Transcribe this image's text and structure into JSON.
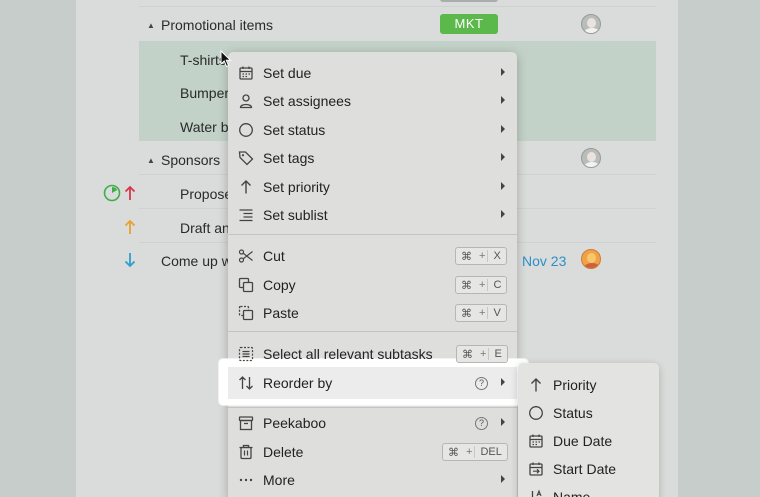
{
  "tasks": {
    "rows": [
      {
        "label": "Promotional items",
        "tag": "MKT"
      },
      {
        "label": "T-shirts"
      },
      {
        "label": "Bumper"
      },
      {
        "label": "Water b"
      },
      {
        "label": "Sponsors"
      },
      {
        "label": "Propose"
      },
      {
        "label": "Draft an"
      },
      {
        "label": "Come up w",
        "date": "Nov 23"
      }
    ]
  },
  "context_menu": {
    "items": [
      {
        "label": "Set due",
        "icon": "calendar-icon",
        "submenu": true
      },
      {
        "label": "Set assignees",
        "icon": "person-icon",
        "submenu": true
      },
      {
        "label": "Set status",
        "icon": "circle-icon",
        "submenu": true
      },
      {
        "label": "Set tags",
        "icon": "tag-icon",
        "submenu": true
      },
      {
        "label": "Set priority",
        "icon": "arrow-up-icon",
        "submenu": true
      },
      {
        "label": "Set sublist",
        "icon": "sublist-icon",
        "submenu": true
      },
      {
        "label": "Cut",
        "icon": "scissors-icon",
        "shortcut": [
          "⌘",
          "+",
          "X"
        ]
      },
      {
        "label": "Copy",
        "icon": "copy-icon",
        "shortcut": [
          "⌘",
          "+",
          "C"
        ]
      },
      {
        "label": "Paste",
        "icon": "paste-icon",
        "shortcut": [
          "⌘",
          "+",
          "V"
        ]
      },
      {
        "label": "Select all relevant subtasks",
        "icon": "select-subtasks-icon",
        "shortcut": [
          "⌘",
          "+",
          "E"
        ]
      },
      {
        "label": "Reorder by",
        "icon": "reorder-icon",
        "help": "?",
        "submenu": true
      },
      {
        "label": "Peekaboo",
        "icon": "archive-box-icon",
        "help": "?",
        "submenu": true
      },
      {
        "label": "Delete",
        "icon": "trash-icon",
        "shortcut": [
          "⌘",
          "+",
          "DEL"
        ]
      },
      {
        "label": "More",
        "icon": "more-dots-icon",
        "submenu": true
      }
    ]
  },
  "reorder_submenu": {
    "items": [
      {
        "label": "Priority",
        "icon": "arrow-up-icon"
      },
      {
        "label": "Status",
        "icon": "circle-icon"
      },
      {
        "label": "Due Date",
        "icon": "calendar-icon"
      },
      {
        "label": "Start Date",
        "icon": "calendar-start-icon"
      },
      {
        "label": "Name",
        "icon": "sort-az-icon"
      }
    ]
  },
  "colors": {
    "tag_mkt": "#5bb84a",
    "date": "#2f8fc9",
    "priority_high": "#d9364a",
    "priority_medium": "#e8a32c",
    "priority_low": "#2f9ed0",
    "status_progress": "#3fae4a",
    "row_highlight": "#c3d2c8"
  }
}
